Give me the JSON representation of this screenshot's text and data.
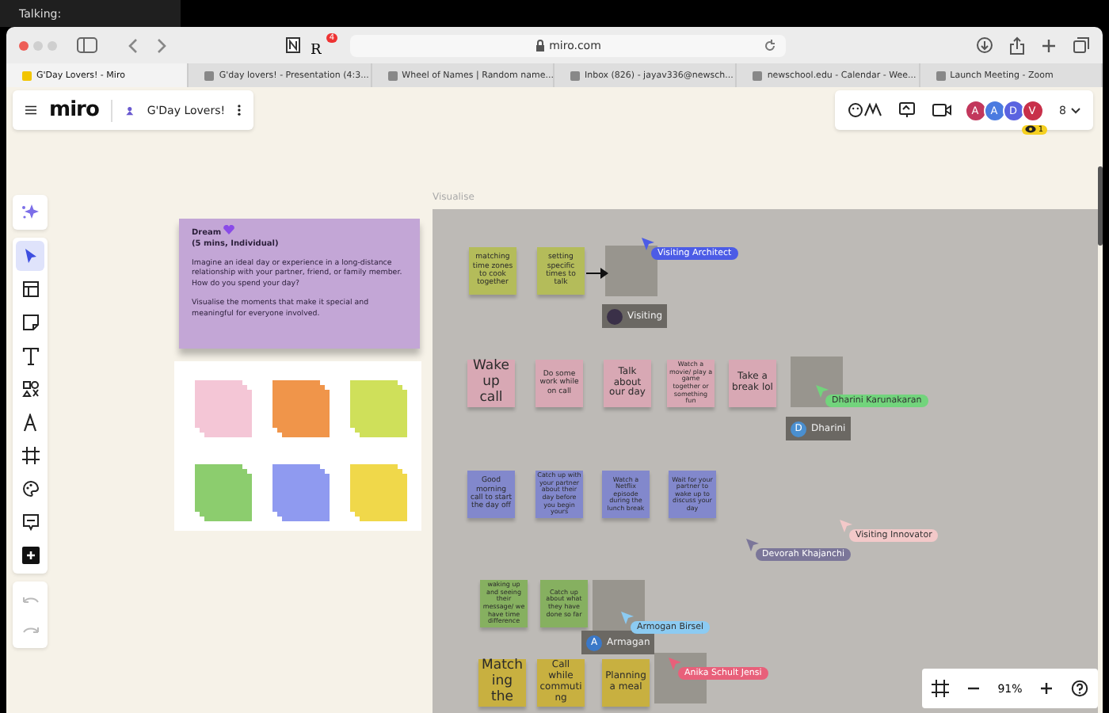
{
  "talking_label": "Talking:",
  "browser": {
    "address": "miro.com",
    "extension_letter": "R",
    "extension_badge": "4",
    "tabs": [
      {
        "title": "G'Day Lovers! - Miro",
        "selected": true
      },
      {
        "title": "G'day lovers! - Presentation (4:3...",
        "selected": false
      },
      {
        "title": "Wheel of Names | Random name...",
        "selected": false
      },
      {
        "title": "Inbox (826) - jayav336@newsch...",
        "selected": false
      },
      {
        "title": "newschool.edu - Calendar - Wee...",
        "selected": false
      },
      {
        "title": "Launch Meeting - Zoom",
        "selected": false
      }
    ]
  },
  "board_bar": {
    "logo": "miro",
    "board_name": "G'Day Lovers!"
  },
  "collaborators": {
    "avatars": [
      {
        "initial": "A",
        "color": "#c2375c"
      },
      {
        "initial": "A",
        "color": "#4b7be0"
      },
      {
        "initial": "D",
        "color": "#5b63e0"
      },
      {
        "initial": "V",
        "color": "#c8304a"
      }
    ],
    "count": "8",
    "viewer_count": "1"
  },
  "toolbar": {
    "tools": [
      {
        "kind": "select",
        "selected": true
      },
      {
        "kind": "templates",
        "selected": false
      },
      {
        "kind": "sticky",
        "selected": false
      },
      {
        "kind": "text",
        "selected": false
      },
      {
        "kind": "shapes",
        "selected": false
      },
      {
        "kind": "pen",
        "selected": false
      },
      {
        "kind": "frame",
        "selected": false
      },
      {
        "kind": "palette",
        "selected": false
      },
      {
        "kind": "comment",
        "selected": false
      },
      {
        "kind": "more",
        "selected": false
      }
    ]
  },
  "instructions": {
    "title": "Dream",
    "subtitle": "(5 mins, Individual)",
    "paragraphs": [
      "Imagine an ideal day or experience in a long-distance relationship with your partner, friend, or family member. How do you spend your day?",
      "Visualise the moments that make it special and meaningful for everyone involved."
    ]
  },
  "sticky_palette": [
    {
      "color": "#f4c6d6"
    },
    {
      "color": "#f0954a"
    },
    {
      "color": "#cfe05a"
    },
    {
      "color": "#8ccd6e"
    },
    {
      "color": "#8f9af0"
    },
    {
      "color": "#f0d84a"
    }
  ],
  "frame": {
    "title": "Visualise",
    "notes": [
      {
        "kind": "sticky",
        "text": "matching time zones to cook together",
        "color": "#b4bc5a"
      },
      {
        "kind": "sticky",
        "text": "setting specific times to talk",
        "color": "#b4bc5a"
      },
      {
        "kind": "placeholder"
      },
      {
        "kind": "sticky",
        "text": "Wake up call",
        "color": "#d8a8b4"
      },
      {
        "kind": "sticky",
        "text": "Do some work while on call",
        "color": "#d8a8b4"
      },
      {
        "kind": "sticky",
        "text": "Talk about our day",
        "color": "#d8a8b4"
      },
      {
        "kind": "sticky",
        "text": "Watch a movie/ play a game together or something fun",
        "color": "#d8a8b4"
      },
      {
        "kind": "sticky",
        "text": "Take a break lol",
        "color": "#d8a8b4"
      },
      {
        "kind": "placeholder"
      },
      {
        "kind": "sticky",
        "text": "Good morning call to start the day off",
        "color": "#8288cc"
      },
      {
        "kind": "sticky",
        "text": "Catch up with your partner about their day before you begin yours",
        "color": "#8288cc"
      },
      {
        "kind": "sticky",
        "text": "Watch a Netflix episode during the lunch break",
        "color": "#8288cc"
      },
      {
        "kind": "sticky",
        "text": "Wait for your partner to wake up to discuss your day",
        "color": "#8288cc"
      },
      {
        "kind": "sticky",
        "text": "waking up and seeing their message/ we have time difference",
        "color": "#86b060"
      },
      {
        "kind": "sticky",
        "text": "Catch up about what they have done so far",
        "color": "#86b060"
      },
      {
        "kind": "placeholder"
      },
      {
        "kind": "sticky",
        "text": "Matching the",
        "color": "#c8b040"
      },
      {
        "kind": "sticky",
        "text": "Call while commuting",
        "color": "#c8b040"
      },
      {
        "kind": "sticky",
        "text": "Planning a meal",
        "color": "#c8b040"
      },
      {
        "kind": "placeholder"
      }
    ],
    "user_tags": [
      {
        "name": "Visiting",
        "color": "#3a3048"
      },
      {
        "name": "Dharini",
        "initial": "D",
        "color": "#4a8fd0"
      },
      {
        "name": "Armagan",
        "initial": "A",
        "color": "#3a78c8"
      }
    ],
    "cursors": [
      {
        "name": "Visiting Architect",
        "color": "#4c5ce6"
      },
      {
        "name": "Dharini Karunakaran",
        "color": "#72d47c"
      },
      {
        "name": "Devorah Khajanchi",
        "color": "#7b7699"
      },
      {
        "name": "Visiting Innovator",
        "color": "#f3c9c9"
      },
      {
        "name": "Armogan Birsel",
        "color": "#8ccbf2"
      },
      {
        "name": "Anika Schult Jensi",
        "color": "#e8607a"
      }
    ]
  },
  "zoom": {
    "level_text": "91%"
  }
}
